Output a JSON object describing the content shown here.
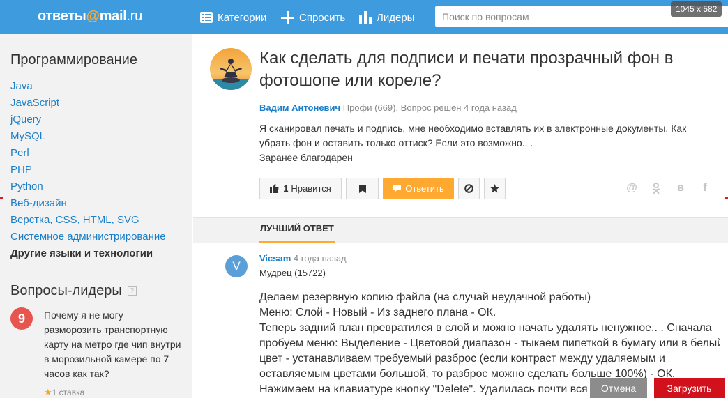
{
  "header": {
    "logo_text": "ответы",
    "logo_at": "@",
    "logo_mail": "mail",
    "logo_ru": ".ru",
    "nav": [
      {
        "label": "Категории",
        "icon": "list-icon"
      },
      {
        "label": "Спросить",
        "icon": "plus-icon"
      },
      {
        "label": "Лидеры",
        "icon": "bar-chart-icon"
      }
    ],
    "search_placeholder": "Поиск по вопросам",
    "size_badge": "1045 x 582",
    "bg_color": "#3e9bde"
  },
  "sidebar": {
    "title": "Программирование",
    "items": [
      {
        "label": "Java"
      },
      {
        "label": "JavaScript"
      },
      {
        "label": "jQuery"
      },
      {
        "label": "MySQL"
      },
      {
        "label": "Perl"
      },
      {
        "label": "PHP"
      },
      {
        "label": "Python"
      },
      {
        "label": "Веб-дизайн"
      },
      {
        "label": "Верстка, CSS, HTML, SVG"
      },
      {
        "label": "Системное администрирование"
      },
      {
        "label": "Другие языки и технологии",
        "active": true
      }
    ],
    "leaders_title": "Вопросы-лидеры",
    "leaders_help": "?",
    "leader": {
      "badge": "9",
      "question": "Почему я не могу разморозить транспортную карту на метро где чип внутри в морозильной камере по 7 часов как так?",
      "stake": "1 ставка"
    }
  },
  "question": {
    "title": "Как сделать для подписи и печати прозрачный фон в фотошопе или кореле?",
    "author": "Вадим Антоневич",
    "meta": "Профи (669), Вопрос решён 4 года назад",
    "text_lines": [
      "Я сканировал печать и подпись, мне необходимо вставлять их в электронные документы. Как",
      "убрать фон и оставить только оттиск? Если это возможно.. .",
      "Заранее благодарен"
    ],
    "like_count": "1",
    "like_label": "Нравится",
    "answer_label": "Ответить",
    "answer_color": "#ffa930",
    "share": [
      {
        "name": "email-share-icon",
        "glyph": "@"
      },
      {
        "name": "odnoklassniki-share-icon",
        "glyph": "ок"
      },
      {
        "name": "vk-share-icon",
        "glyph": "в"
      },
      {
        "name": "facebook-share-icon",
        "glyph": "f"
      }
    ]
  },
  "best_answer": {
    "tab_label": "ЛУЧШИЙ ОТВЕТ",
    "avatar_letter": "V",
    "author": "Vicsam",
    "time": "4 года назад",
    "rank": "Мудрец (15722)",
    "lines": [
      "Делаем резервную копию файла (на случай неудачной работы)",
      "Меню: Слой - Новый - Из заднего плана - ОК.",
      "Теперь задний план превратился в слой и можно начать удалять ненужное.. . Сначала",
      "пробуем меню: Выделение - Цветовой диапазон - тыкаем пипеткой в бумагу или в белый",
      "цвет - устанавливаем требуемый разброс (если контраст между удаляемым и",
      "оставляемым цветами большой, то разброс можно сделать больше 100%) - ОК.",
      "Нажимаем на клавиатуре кнопку \"Delete\". Удалилась почти вся бумага"
    ]
  },
  "overlay": {
    "cancel_label": "Отмена",
    "upload_label": "Загрузить",
    "upload_color": "#d1121c"
  }
}
